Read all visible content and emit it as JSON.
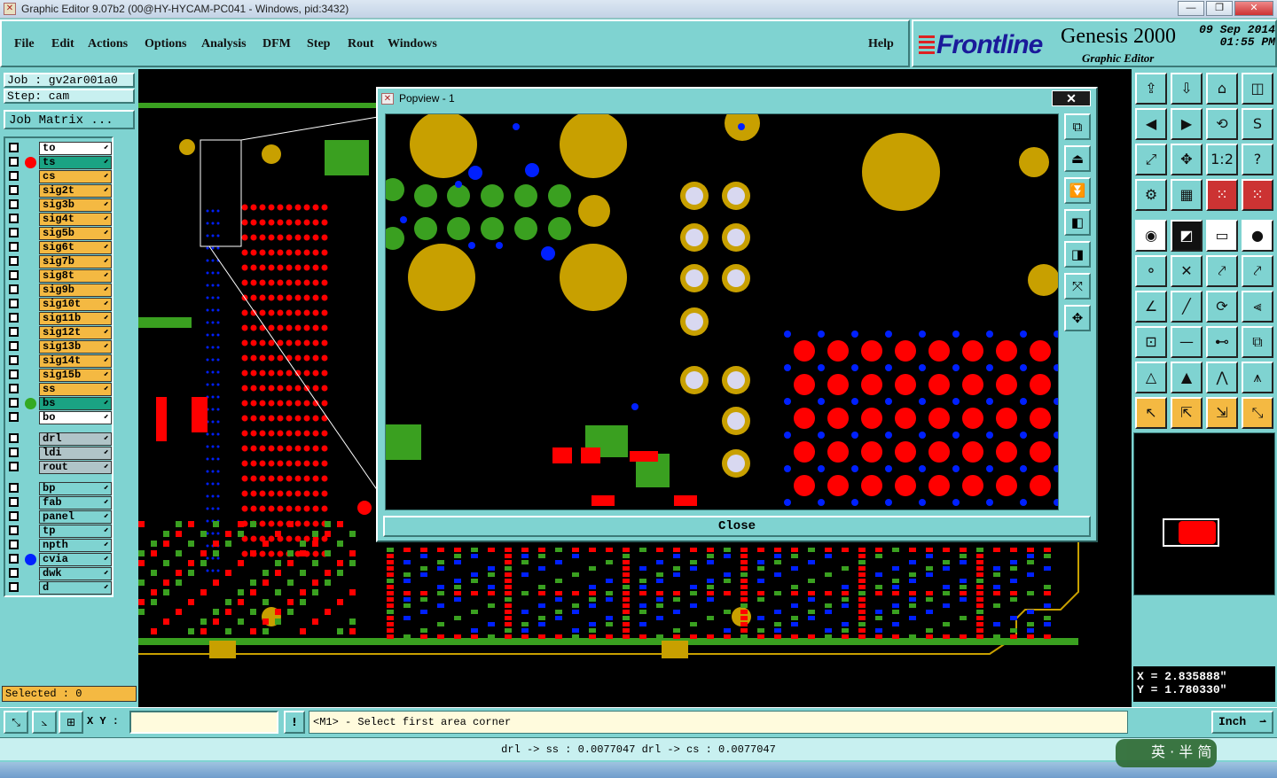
{
  "window": {
    "title": "Graphic Editor 9.07b2 (00@HY-HYCAM-PC041 - Windows, pid:3432)",
    "min": "—",
    "max": "❐",
    "close": "✕"
  },
  "menu": {
    "file": "File",
    "edit": "Edit",
    "actions": "Actions",
    "options": "Options",
    "analysis": "Analysis",
    "dfm": "DFM",
    "step": "Step",
    "rout": "Rout",
    "windows": "Windows",
    "help": "Help"
  },
  "brand": {
    "logo": "Frontline",
    "title": "Genesis 2000",
    "subtitle": "Graphic Editor",
    "date": "09 Sep 2014",
    "time": "01:55 PM"
  },
  "job": {
    "job_line": "Job : gv2ar001a0",
    "step_line": "Step: cam",
    "matrix_button": "Job Matrix ..."
  },
  "layers": [
    {
      "name": "to",
      "color": "#ffffff",
      "dot": ""
    },
    {
      "name": "ts",
      "color": "#1aa383",
      "dot": "#ff0000"
    },
    {
      "name": "cs",
      "color": "#f4b942",
      "dot": ""
    },
    {
      "name": "sig2t",
      "color": "#f4b942",
      "dot": ""
    },
    {
      "name": "sig3b",
      "color": "#f4b942",
      "dot": ""
    },
    {
      "name": "sig4t",
      "color": "#f4b942",
      "dot": ""
    },
    {
      "name": "sig5b",
      "color": "#f4b942",
      "dot": ""
    },
    {
      "name": "sig6t",
      "color": "#f4b942",
      "dot": ""
    },
    {
      "name": "sig7b",
      "color": "#f4b942",
      "dot": ""
    },
    {
      "name": "sig8t",
      "color": "#f4b942",
      "dot": ""
    },
    {
      "name": "sig9b",
      "color": "#f4b942",
      "dot": ""
    },
    {
      "name": "sig10t",
      "color": "#f4b942",
      "dot": ""
    },
    {
      "name": "sig11b",
      "color": "#f4b942",
      "dot": ""
    },
    {
      "name": "sig12t",
      "color": "#f4b942",
      "dot": ""
    },
    {
      "name": "sig13b",
      "color": "#f4b942",
      "dot": ""
    },
    {
      "name": "sig14t",
      "color": "#f4b942",
      "dot": ""
    },
    {
      "name": "sig15b",
      "color": "#f4b942",
      "dot": ""
    },
    {
      "name": "ss",
      "color": "#f4b942",
      "dot": ""
    },
    {
      "name": "bs",
      "color": "#1aa383",
      "dot": "#33aa22"
    },
    {
      "name": "bo",
      "color": "#ffffff",
      "dot": ""
    },
    {
      "name": "drl",
      "color": "#b0c4c8",
      "dot": ""
    },
    {
      "name": "ldi",
      "color": "#b0c4c8",
      "dot": ""
    },
    {
      "name": "rout",
      "color": "#b0c4c8",
      "dot": ""
    },
    {
      "name": "bp",
      "color": "#7fd3d1",
      "dot": ""
    },
    {
      "name": "fab",
      "color": "#7fd3d1",
      "dot": ""
    },
    {
      "name": "panel",
      "color": "#7fd3d1",
      "dot": ""
    },
    {
      "name": "tp",
      "color": "#7fd3d1",
      "dot": ""
    },
    {
      "name": "npth",
      "color": "#7fd3d1",
      "dot": ""
    },
    {
      "name": "cvia",
      "color": "#7fd3d1",
      "dot": "#0022ff"
    },
    {
      "name": "dwk",
      "color": "#7fd3d1",
      "dot": ""
    },
    {
      "name": "d",
      "color": "#7fd3d1",
      "dot": ""
    }
  ],
  "selected": "Selected : 0",
  "popview": {
    "title": "Popview - 1",
    "close_x": "✕",
    "close_button": "Close"
  },
  "coords": {
    "x": "X = 2.835888\"",
    "y": "Y = 1.780330\""
  },
  "bottom": {
    "xy_label": "X Y :",
    "xy_value": "",
    "prompt": "<M1> - Select first area corner",
    "units": "Inch"
  },
  "status": "drl -> ss : 0.0077047   drl -> cs : 0.0077047",
  "ime": "英 · 半 简",
  "colors": {
    "pad_gold": "#c8a000",
    "pad_green": "#3aa020",
    "pad_red": "#ff0000",
    "via_blue": "#0020ff",
    "bg_teal": "#7fd3d1"
  }
}
